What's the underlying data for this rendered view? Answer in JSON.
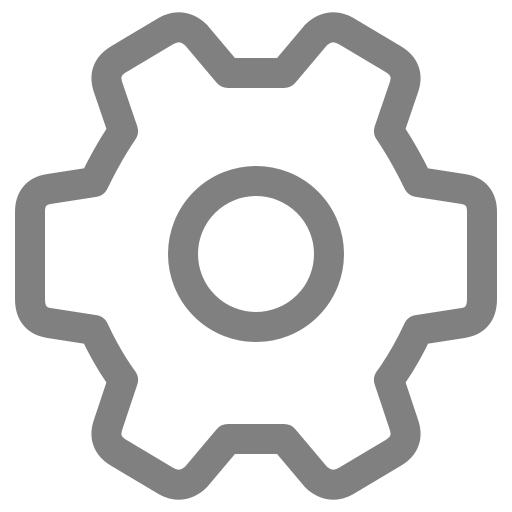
{
  "icon": {
    "name": "gear-icon",
    "stroke_color": "#808080",
    "background_color": "#ffffff"
  }
}
